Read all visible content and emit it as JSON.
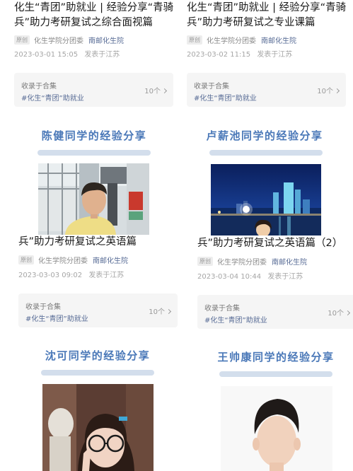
{
  "articles": [
    {
      "title_line1": "化生“青团”助就业 | 经验分享“青骑",
      "title_line2": "兵”助力考研复试之综合面视篇",
      "badge": "原创",
      "author": "化生学院分团委",
      "account": "南邮化生院",
      "date": "2023-03-01 15:05",
      "location": "发表于江苏",
      "collection_label": "收录于合集",
      "collection_tag": "#化生“青团”助就业",
      "collection_count": "10个",
      "banner": "陈健同学的经验分享"
    },
    {
      "title_line1": "化生“青团”助就业 | 经验分享“青骑",
      "title_line2": "兵”助力考研复试之专业课篇",
      "badge": "原创",
      "author": "化生学院分团委",
      "account": "南邮化生院",
      "date": "2023-03-02 11:15",
      "location": "发表于江苏",
      "collection_label": "收录于合集",
      "collection_tag": "#化生“青团”助就业",
      "collection_count": "10个",
      "banner": "卢薪池同学的经验分享"
    },
    {
      "title_line2": "兵”助力考研复试之英语篇",
      "badge": "原创",
      "author": "化生学院分团委",
      "account": "南邮化生院",
      "date": "2023-03-03 09:02",
      "location": "发表于江苏",
      "collection_label": "收录于合集",
      "collection_tag": "#化生“青团”助就业",
      "collection_count": "10个",
      "banner": "沈可同学的经验分享"
    },
    {
      "title_line2": "兵”助力考研复试之英语篇（2）",
      "badge": "原创",
      "author": "化生学院分团委",
      "account": "南邮化生院",
      "date": "2023-03-04 10:44",
      "location": "发表于江苏",
      "collection_label": "收录于合集",
      "collection_tag": "#化生“青团”助就业",
      "collection_count": "10个",
      "banner": "王帅康同学的经验分享"
    }
  ]
}
